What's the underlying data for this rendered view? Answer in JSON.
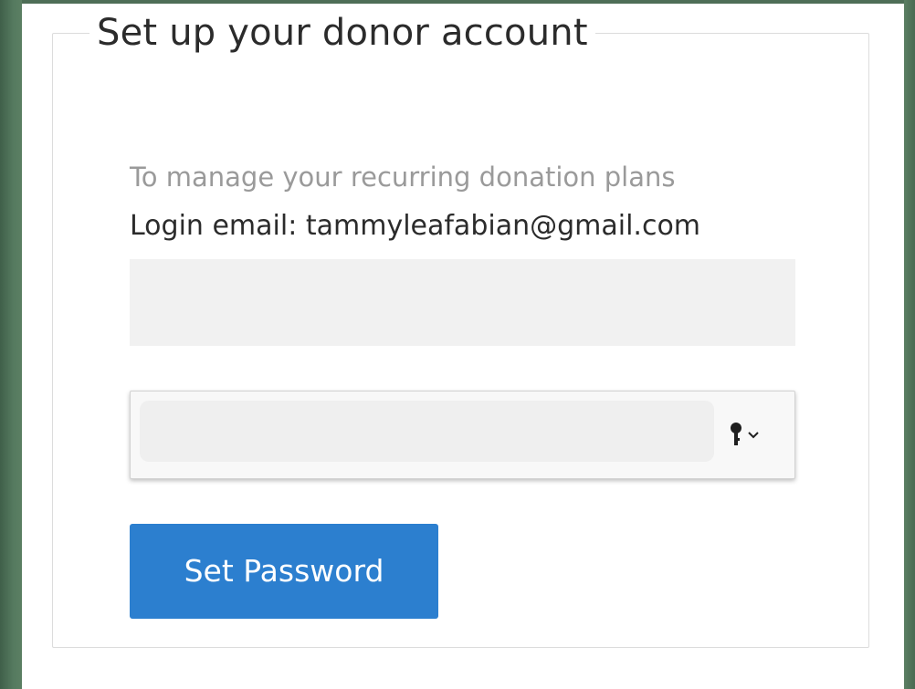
{
  "form": {
    "title": "Set up your donor account",
    "subtitle": "To manage your recurring donation plans",
    "login_email_label": "Login email:",
    "login_email_value": "tammyleafabian@gmail.com",
    "login_email_text": "Login email: tammyleafabian@gmail.com",
    "field_one_value": "",
    "password_value": "",
    "password_icons": [
      "key-icon",
      "chevron-down-icon"
    ],
    "submit_label": "Set Password"
  },
  "colors": {
    "background": "#4e6e57",
    "panel": "#ffffff",
    "button": "#2c7fcf",
    "field": "#f1f1f1",
    "muted_text": "#9a9a9a",
    "text": "#2b2b2b"
  }
}
